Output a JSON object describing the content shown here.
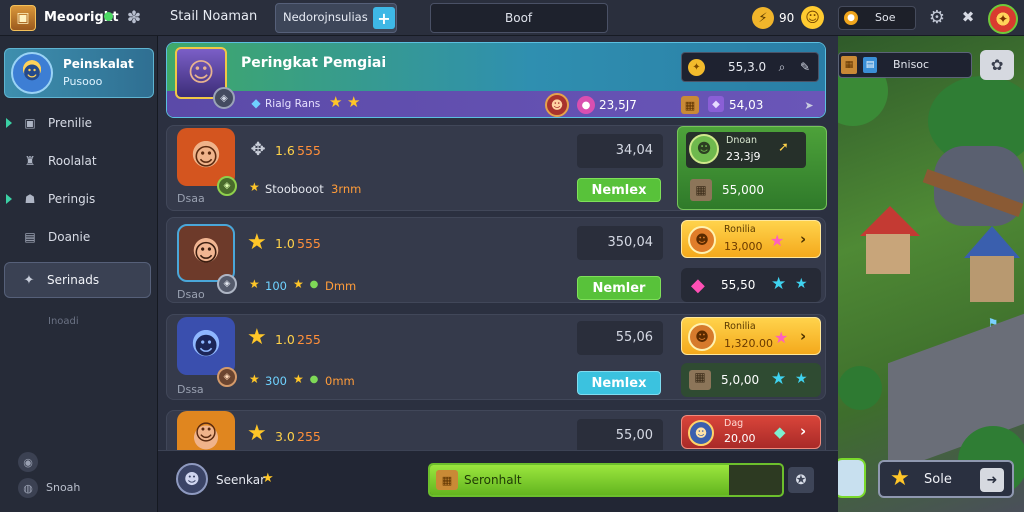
{
  "colors": {
    "accent_green": "#58c23a",
    "accent_cyan": "#3bc2df",
    "gold": "#ffc628",
    "purple": "#8a5fd6",
    "bar_green": "#7ad92c"
  },
  "topbar": {
    "app_title": "Meoorigkt",
    "tab_left": "Stail Noaman",
    "tab_active": "Nedorojnsulias",
    "center_label": "Boof",
    "coin_value": "90",
    "currency_label": "Soe"
  },
  "sidebar": {
    "profile": {
      "name": "Peinskalat",
      "sub": "Pusooo"
    },
    "items": [
      {
        "label": "Prenilie",
        "icon": "shield-icon"
      },
      {
        "label": "Roolalat",
        "icon": "tower-icon"
      },
      {
        "label": "Peringis",
        "icon": "people-icon"
      },
      {
        "label": "Doanie",
        "icon": "document-icon"
      },
      {
        "label": "Serinads",
        "icon": "gear-icon",
        "active": true
      }
    ],
    "faded_label": "Inoadi",
    "bottom_label": "Snoah"
  },
  "banner": {
    "title": "Peringkat Pemgiai",
    "search_value": "55,3.0",
    "sub_label": "Rialg Rans",
    "stat1": "23,5J7",
    "stat2": "54,03"
  },
  "rows": [
    {
      "level": "1.6",
      "score": "555",
      "name": "Stoobooot",
      "name_suffix": "3rnm",
      "small": "Dsaa",
      "value": "34,04",
      "button": "Nemlex",
      "button_color": "green",
      "reward_title": "Dnoan",
      "reward_value": "23,3j9",
      "reward_sub": "55,000",
      "reward_style": "green"
    },
    {
      "level": "1.0",
      "score": "555",
      "name": "100",
      "name_suffix": "Dmm",
      "small": "Dsao",
      "value": "350,04",
      "button": "Nemler",
      "button_color": "green",
      "reward_title": "Ronilia",
      "reward_value": "13,000",
      "reward_sub": "55,50",
      "reward_style": "gold"
    },
    {
      "level": "1.0",
      "score": "255",
      "name": "300",
      "name_suffix": "0mm",
      "small": "Dssa",
      "value": "55,06",
      "button": "Nemlex",
      "button_color": "cyan",
      "reward_title": "Ronilia",
      "reward_value": "1,320.00",
      "reward_sub": "5,0,00",
      "reward_style": "gold"
    },
    {
      "level": "3.0",
      "score": "255",
      "name": "",
      "name_suffix": "",
      "small": "",
      "value": "55,00",
      "button": "",
      "button_color": "none",
      "reward_title": "Dag",
      "reward_value": "20,00",
      "reward_sub": "",
      "reward_style": "red"
    }
  ],
  "footer": {
    "player_name": "Seenkar",
    "progress_label": "Seronhalt",
    "progress": 0.85
  },
  "world": {
    "search_label": "Bnisoc",
    "action_label": "Sole"
  }
}
